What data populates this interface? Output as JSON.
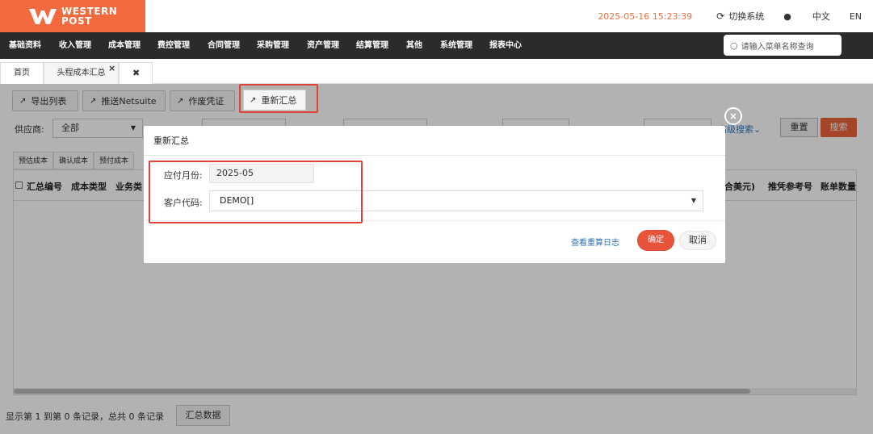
{
  "brand": {
    "line1": "WESTERN",
    "line2": "POST"
  },
  "header": {
    "datetime": "2025-05-16 15:23:39",
    "switch_label": "切换系统",
    "lang_cn": "中文",
    "lang_en": "EN",
    "accent": "#f26a3d"
  },
  "nav": {
    "items": [
      "基础资料",
      "收入管理",
      "成本管理",
      "费控管理",
      "合同管理",
      "采购管理",
      "资产管理",
      "结算管理",
      "其他",
      "系统管理",
      "报表中心"
    ],
    "search_placeholder": "请输入菜单名称查询"
  },
  "tabs": {
    "home": "首页",
    "current": "头程成本汇总"
  },
  "toolbar": {
    "export": "导出列表",
    "push": "推送Netsuite",
    "void": "作废凭证",
    "resummarize": "重新汇总"
  },
  "filters": {
    "supplier_label": "供应商:",
    "supplier_value": "全部",
    "advanced": "高级搜索",
    "reset": "重置",
    "search": "搜索"
  },
  "subtabs": [
    "预估成本",
    "确认成本",
    "预付成本"
  ],
  "table": {
    "columns": [
      "汇总编号",
      "成本类型",
      "业务类",
      "合美元)",
      "推凭参考号",
      "账单数量"
    ]
  },
  "footer": {
    "record_text": "显示第 1 到第 0 条记录，总共 0 条记录",
    "summary_button": "汇总数据"
  },
  "modal": {
    "title": "重新汇总",
    "month_label": "应付月份:",
    "month_value": "2025-05",
    "customer_label": "客户代码:",
    "customer_value": "DEMO[]",
    "log_link": "查看重算日志",
    "ok": "确定",
    "cancel": "取消"
  }
}
